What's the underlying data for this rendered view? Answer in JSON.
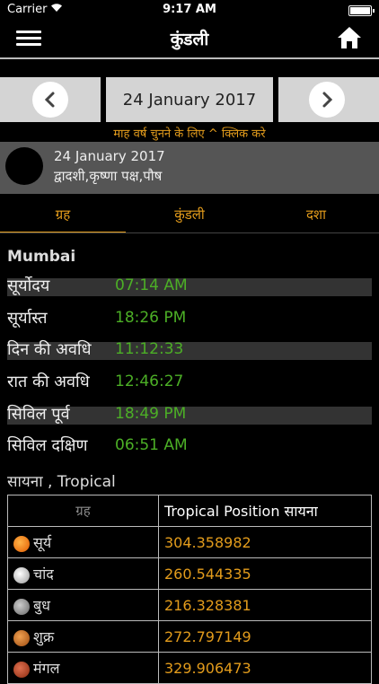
{
  "status": {
    "carrier": "Carrier",
    "time": "9:17 AM"
  },
  "nav": {
    "title": "कुंडली"
  },
  "datebar": {
    "date": "24 January 2017",
    "hint": "माह वर्ष चुनने के लिए ^ क्लिक करे"
  },
  "day": {
    "date": "24 January 2017",
    "tithi": "द्वादशी,कृष्णा पक्ष,पौष"
  },
  "tabs": [
    "ग्रह",
    "कुंडली",
    "दशा"
  ],
  "city": "Mumbai",
  "rows": [
    {
      "label": "सूर्योदय",
      "value": "07:14 AM"
    },
    {
      "label": "सूर्यास्त",
      "value": "18:26 PM"
    },
    {
      "label": "दिन की अवधि",
      "value": "11:12:33"
    },
    {
      "label": "रात की अवधि",
      "value": "12:46:27"
    },
    {
      "label": "सिविल पूर्व",
      "value": "18:49 PM"
    },
    {
      "label": "सिविल दक्षिण",
      "value": "06:51 AM"
    }
  ],
  "section": "सायना , Tropical",
  "table": {
    "headers": [
      "ग्रह",
      "Tropical Position सायना"
    ],
    "rows": [
      {
        "planet": "सूर्य",
        "icon": "sun-icon",
        "value": "304.358982"
      },
      {
        "planet": "चांद",
        "icon": "moon-icon",
        "value": "260.544335"
      },
      {
        "planet": "बुध",
        "icon": "mercury-icon",
        "value": "216.328381"
      },
      {
        "planet": "शुक्र",
        "icon": "venus-icon",
        "value": "272.797149"
      },
      {
        "planet": "मंगल",
        "icon": "mars-icon",
        "value": "329.906473"
      }
    ]
  },
  "colors": {
    "accent": "#e39c1c",
    "green": "#4caf26",
    "panel": "#555555"
  }
}
